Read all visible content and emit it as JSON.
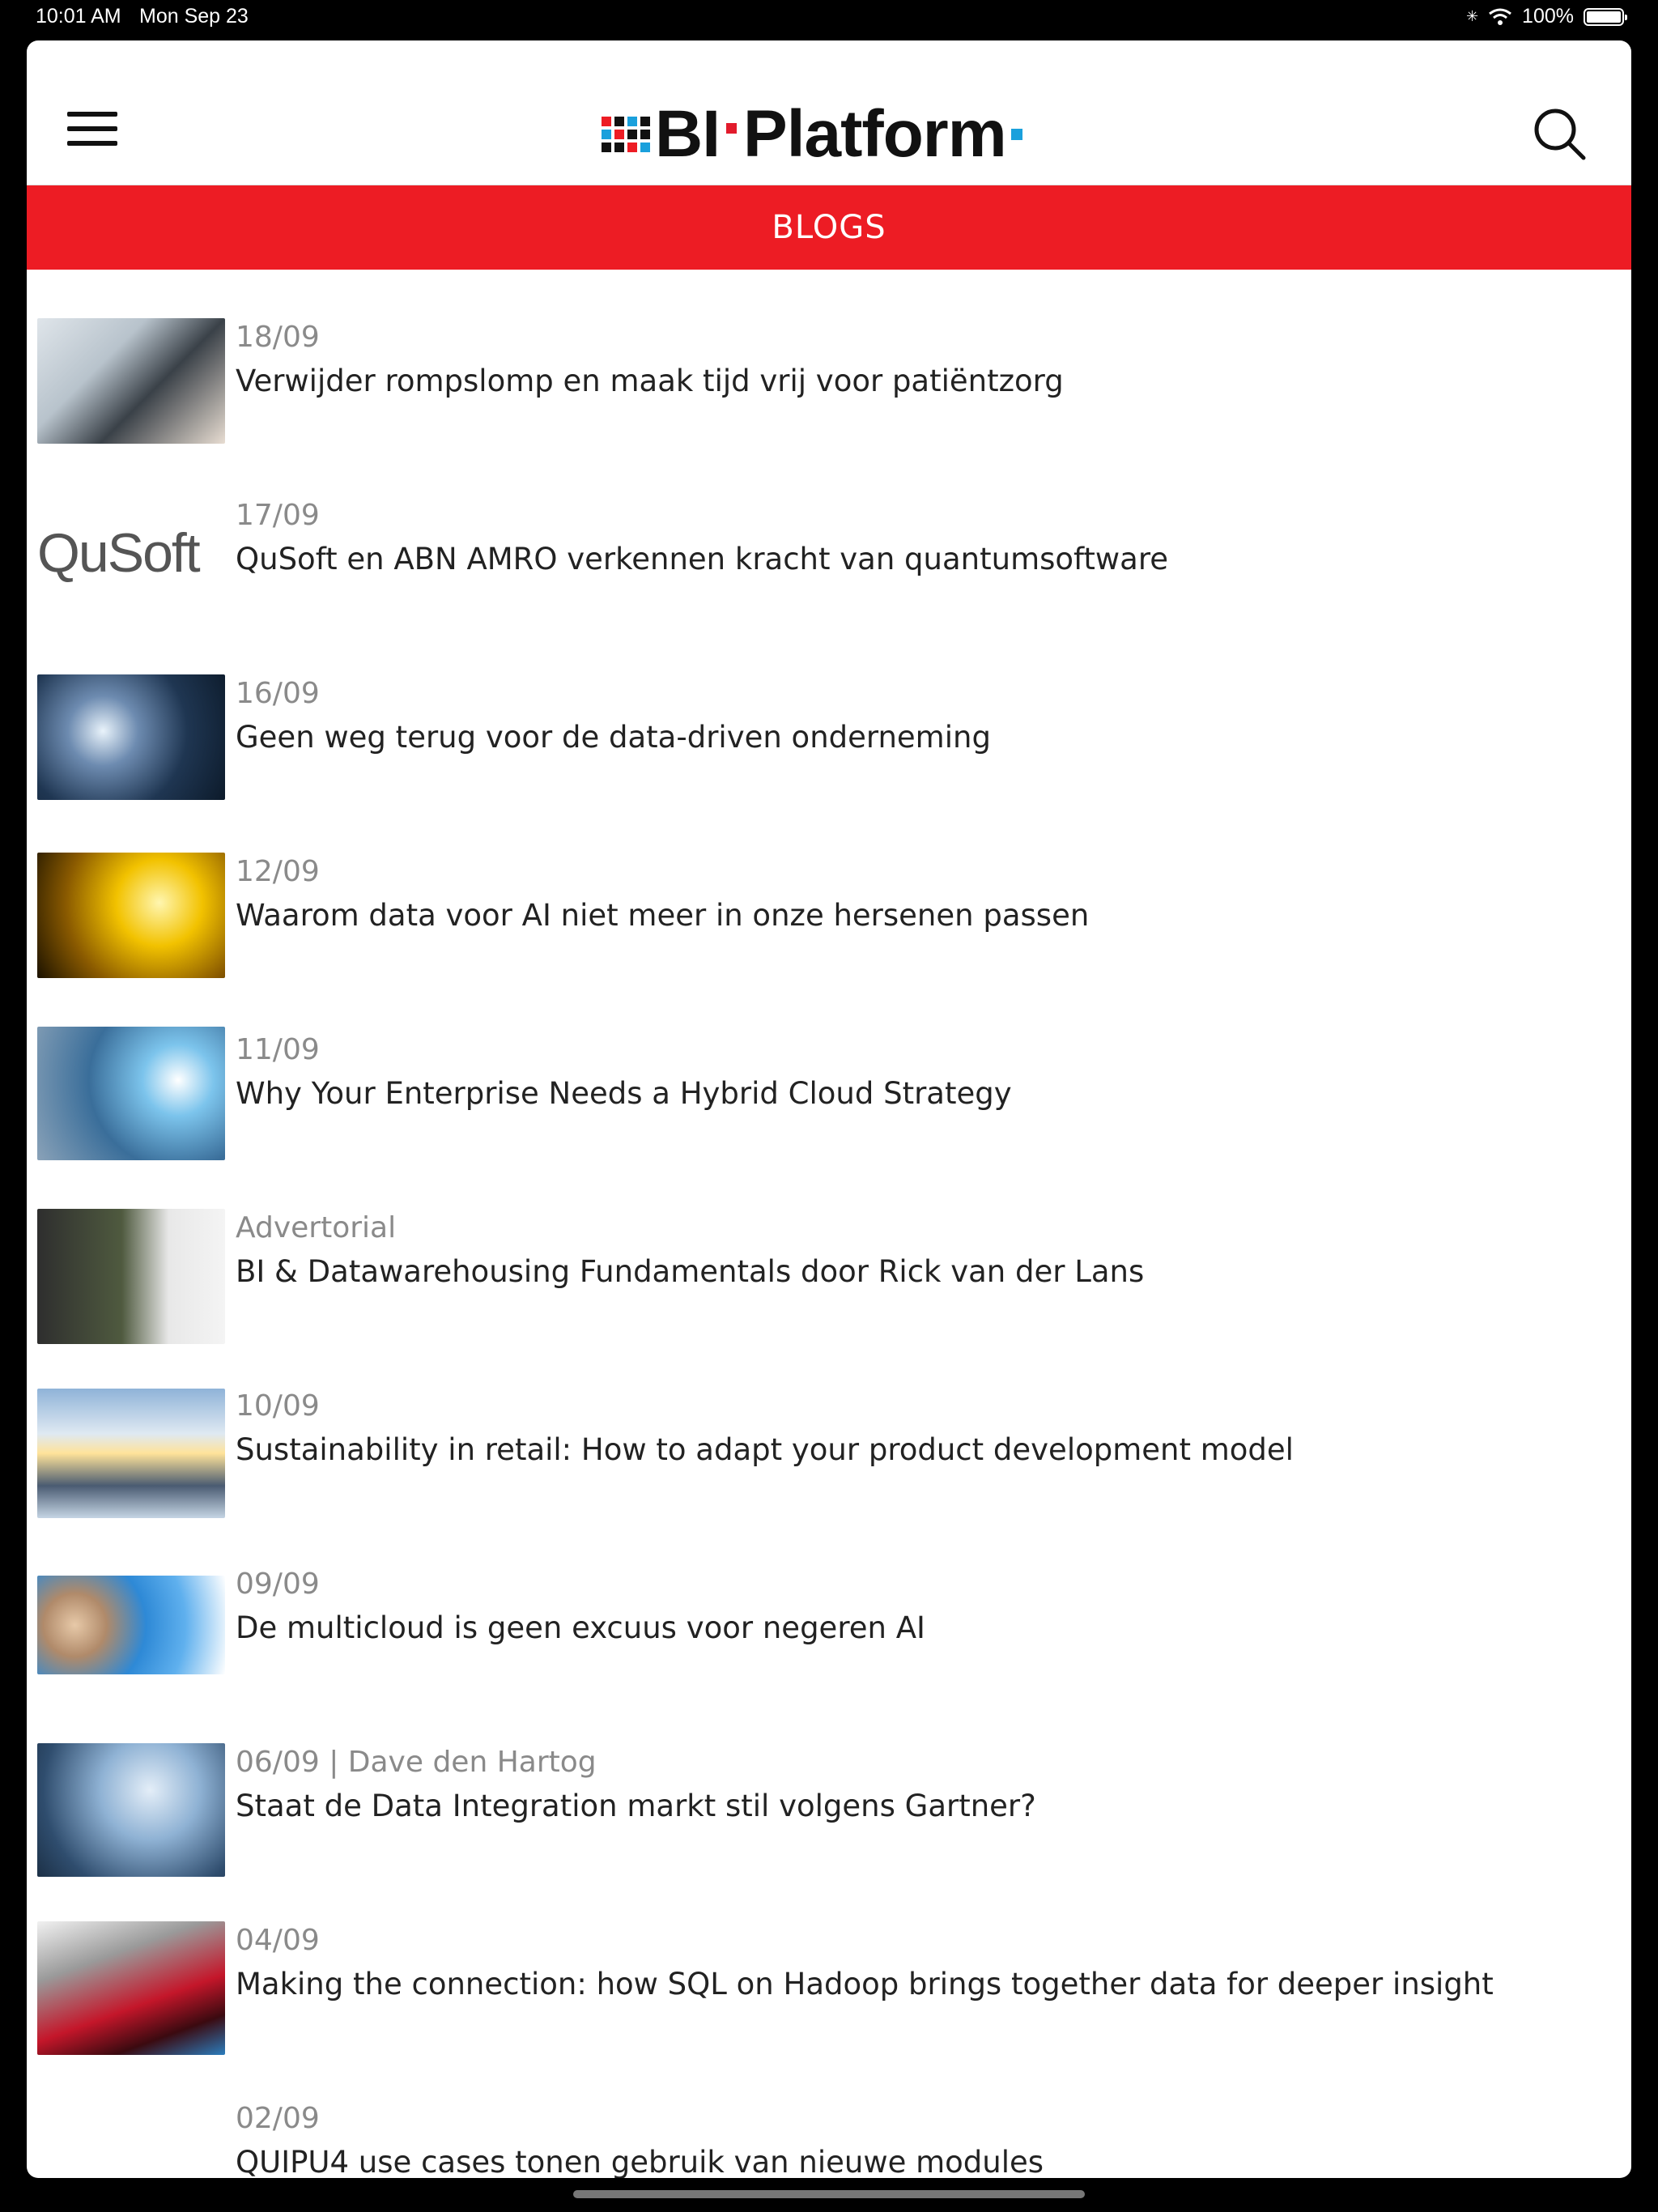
{
  "status_bar": {
    "time": "10:01 AM",
    "date": "Mon Sep 23",
    "battery": "100%"
  },
  "header": {
    "logo_left": "BI",
    "logo_right": "Platform",
    "menu_icon": "hamburger-menu-icon",
    "search_icon": "search-icon"
  },
  "category": {
    "label": "BLOGS"
  },
  "colors": {
    "brand_red": "#ed1c24",
    "logo_blue": "#1aa0dc"
  },
  "articles": [
    {
      "meta": "18/09",
      "title": "Verwijder rompslomp en maak tijd vrij voor patiëntzorg",
      "thumb": "lab-equipment"
    },
    {
      "meta": "17/09",
      "title": "QuSoft en ABN AMRO verkennen kracht van quantumsoftware",
      "thumb": "qusoft-logo",
      "thumb_text": "QuSoft"
    },
    {
      "meta": "16/09",
      "title": "Geen weg terug voor de data-driven onderneming",
      "thumb": "analysis-wordcloud"
    },
    {
      "meta": "12/09",
      "title": "Waarom data voor AI niet meer in onze hersenen passen",
      "thumb": "golden-data-grid"
    },
    {
      "meta": "11/09",
      "title": "Why Your Enterprise Needs a Hybrid Cloud Strategy",
      "thumb": "cloud-touchscreen"
    },
    {
      "meta": "Advertorial",
      "title": "BI & Datawarehousing Fundamentals door Rick van der Lans",
      "thumb": "presenter-photo"
    },
    {
      "meta": "10/09",
      "title": "Sustainability in retail: How to adapt your product development model",
      "thumb": "business-silhouettes"
    },
    {
      "meta": "09/09",
      "title": "De multicloud is geen excuus voor negeren AI",
      "thumb": "man-with-clouds"
    },
    {
      "meta": "06/09 | Dave den Hartog",
      "title": "Staat de Data Integration markt stil volgens Gartner?",
      "thumb": "digital-map-hand"
    },
    {
      "meta": "04/09",
      "title": "Making the connection: how SQL on Hadoop brings together data for deeper insight",
      "thumb": "server-rack-red"
    },
    {
      "meta": "02/09",
      "title": "QUIPU4 use cases tonen gebruik van nieuwe modules",
      "thumb": "none"
    }
  ]
}
